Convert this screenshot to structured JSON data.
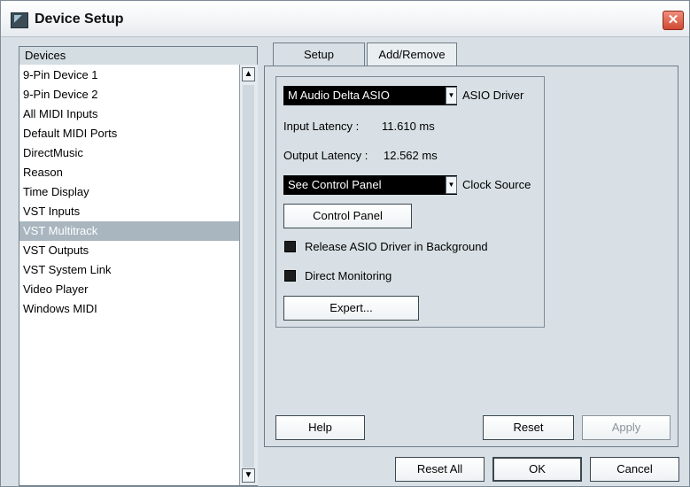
{
  "window": {
    "title": "Device Setup",
    "close_glyph": "✕"
  },
  "devices": {
    "header": "Devices",
    "items": [
      "9-Pin Device 1",
      "9-Pin Device 2",
      "All MIDI Inputs",
      "Default MIDI Ports",
      "DirectMusic",
      "Reason",
      "Time Display",
      "VST Inputs",
      "VST Multitrack",
      "VST Outputs",
      "VST System Link",
      "Video Player",
      "Windows MIDI"
    ],
    "selected": "VST Multitrack"
  },
  "tabs": {
    "setup": "Setup",
    "add_remove": "Add/Remove"
  },
  "setup": {
    "driver_value": "M Audio Delta ASIO",
    "driver_label": "ASIO Driver",
    "input_latency_label": "Input Latency :",
    "input_latency_value": "11.610 ms",
    "output_latency_label": "Output Latency :",
    "output_latency_value": "12.562 ms",
    "clock_value": "See Control Panel",
    "clock_label": "Clock Source",
    "control_panel_button": "Control Panel",
    "release_asio_label": "Release ASIO Driver in Background",
    "direct_monitoring_label": "Direct Monitoring",
    "expert_button": "Expert..."
  },
  "buttons": {
    "help": "Help",
    "reset": "Reset",
    "apply": "Apply",
    "reset_all": "Reset All",
    "ok": "OK",
    "cancel": "Cancel"
  },
  "icons": {
    "app": "device-setup-icon",
    "close": "close-icon",
    "scroll_up": "chevron-up-icon",
    "scroll_down": "chevron-down-icon",
    "dropdown": "chevron-down-icon"
  }
}
